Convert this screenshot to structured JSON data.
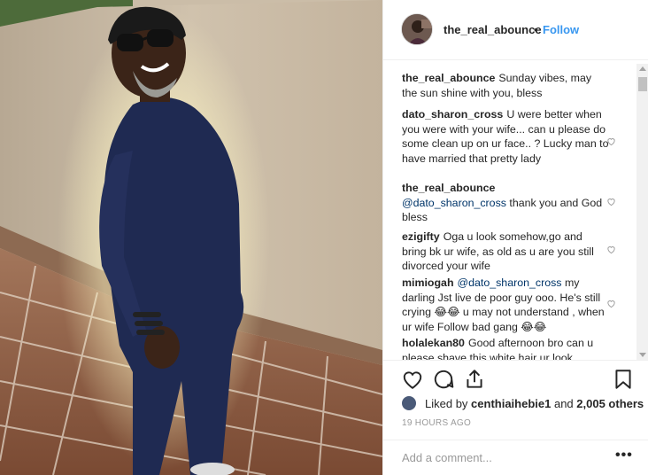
{
  "post": {
    "username": "the_real_abounce",
    "separator": "•",
    "follow_label": "Follow"
  },
  "comments": [
    {
      "user": "the_real_abounce",
      "text": "Sunday vibes, may the sun shine with you, bless",
      "mention": ""
    },
    {
      "user": "dato_sharon_cross",
      "text": "U were better when you were with your wife... can u please do some clean up on ur face.. ? Lucky man to have married that pretty lady",
      "mention": ""
    },
    {
      "user": "the_real_abounce",
      "mention": "@dato_sharon_cross",
      "text": " thank you and God bless"
    },
    {
      "user": "ezigifty",
      "text": "Oga u look somehow,go and bring bk ur wife, as old as u are you still divorced your wife",
      "mention": ""
    },
    {
      "user": "mimiogah",
      "mention": "@dato_sharon_cross",
      "text": " my darling Jst live de poor guy ooo. He's still crying 😂😂 u may not understand , when ur wife Follow bad gang 😂😂"
    },
    {
      "user": "holalekan80",
      "text": "Good afternoon bro can u please shave this white hair ur look",
      "mention": ""
    }
  ],
  "icons": {
    "like": "heart-icon",
    "comment": "comment-icon",
    "share": "share-icon",
    "save": "bookmark-icon",
    "comment_like": "heart-outline-icon",
    "more": "more-options-icon"
  },
  "likes": {
    "prefix": "Liked by ",
    "user": "centhiaihebie1",
    "middle": " and ",
    "count": "2,005 others"
  },
  "timestamp": "19 HOURS AGO",
  "add_comment": {
    "placeholder": "Add a comment...",
    "more_label": "•••"
  },
  "colors": {
    "link": "#3897f0",
    "mention": "#003569",
    "muted": "#999999",
    "text": "#262626",
    "border": "#efefef"
  }
}
